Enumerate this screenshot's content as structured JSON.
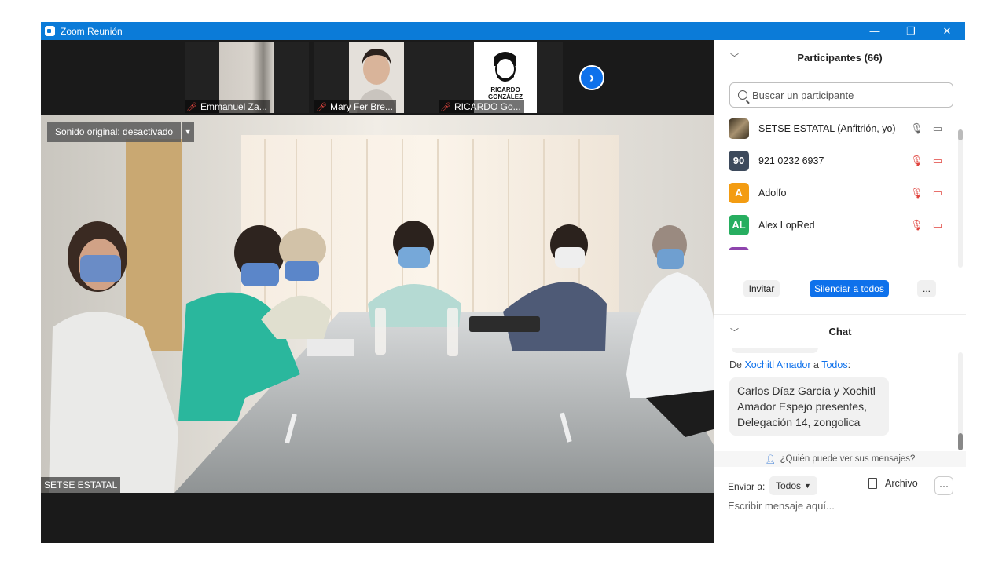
{
  "window": {
    "title": "Zoom Reunión"
  },
  "titlebar_controls": [
    "—",
    "❐",
    "✕"
  ],
  "thumbnails": [
    {
      "name": "Emmanuel Za..."
    },
    {
      "name": "Mary Fer Bre..."
    },
    {
      "name": "RICARDO Go...",
      "logo_text": "RICARDO GONZÁLEZ"
    }
  ],
  "main_video": {
    "sound_button": "Sonido original: desactivado",
    "speaker": "SETSE ESTATAL"
  },
  "participants": {
    "title": "Participantes (66)",
    "search_placeholder": "Buscar un participante",
    "list": [
      {
        "name": "SETSE ESTATAL (Anfitrión, yo)",
        "initials": "",
        "color": "#6b5a3f",
        "muted": false
      },
      {
        "name": "921 0232 6937",
        "initials": "90",
        "color": "#3d4a5c",
        "muted": true
      },
      {
        "name": "Adolfo",
        "initials": "A",
        "color": "#f39c12",
        "muted": true
      },
      {
        "name": "Alex LopRed",
        "initials": "AL",
        "color": "#27ae60",
        "muted": true
      }
    ],
    "invite_label": "Invitar",
    "mute_all_label": "Silenciar a todos",
    "more_label": "..."
  },
  "chat": {
    "title": "Chat",
    "message": {
      "prefix": "De",
      "sender": "Xochitl Amador",
      "connector": "a",
      "recipient": "Todos",
      "suffix": ":",
      "text": "Carlos Díaz García y Xochitl Amador Espejo presentes, Delegación 14, zongolica"
    },
    "who_sees": "¿Quién puede ver sus mensajes?",
    "send_to_label": "Enviar a:",
    "send_to_value": "Todos",
    "file_label": "Archivo",
    "input_placeholder": "Escribir mensaje aquí..."
  },
  "colors": {
    "accent": "#0e71eb",
    "titlebar": "#0b7bd8",
    "muted": "#e0443e"
  }
}
